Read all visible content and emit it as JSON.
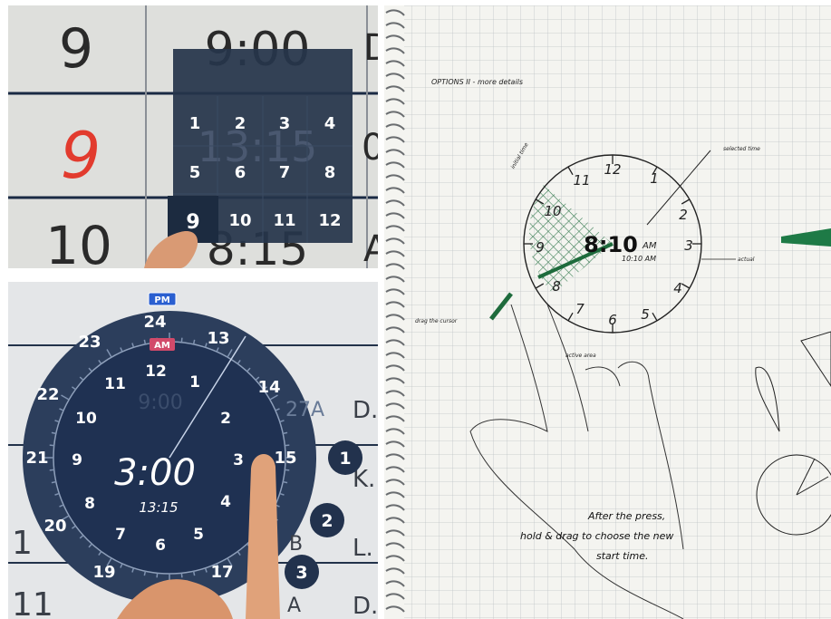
{
  "panel1": {
    "row_hours": [
      "9",
      "9",
      "10"
    ],
    "cells": [
      "9:00",
      "13:15",
      "8:15"
    ],
    "row_edge_letters": [
      "D",
      "0",
      "A"
    ],
    "keypad_keys": [
      "1",
      "2",
      "3",
      "4",
      "5",
      "6",
      "7",
      "8",
      "9",
      "10",
      "11",
      "12"
    ],
    "pressed_key": "9"
  },
  "panel2": {
    "pm_badge": "PM",
    "am_badge": "AM",
    "outer_hours": [
      "24",
      "13",
      "14",
      "15",
      "17",
      "19",
      "20",
      "21",
      "22",
      "23"
    ],
    "inner_hours": [
      "12",
      "1",
      "2",
      "3",
      "4",
      "5",
      "6",
      "7",
      "8",
      "9",
      "10",
      "11"
    ],
    "time_display": "3:00",
    "time_24h": "13:15",
    "right_letters": [
      "D.",
      "K.",
      "L.",
      "D."
    ],
    "left_edge": [
      "1",
      "11"
    ],
    "right_fragments": [
      "27A",
      "B",
      "A"
    ],
    "bubbles": [
      "1",
      "2",
      "3"
    ],
    "behind_text": "9:00"
  },
  "sketch": {
    "title": "OPTIONS II - more details",
    "clock_numbers": [
      "12",
      "1",
      "2",
      "3",
      "4",
      "5",
      "6",
      "7",
      "8",
      "9",
      "10",
      "11"
    ],
    "time_big": "8:10",
    "am_label": "AM",
    "subtime": "10:10 AM",
    "label_selected_time": "selected time",
    "label_initial_time": "initial time",
    "label_actual": "actual",
    "label_drag": "drag the cursor",
    "label_active_area": "active area",
    "note_line1": "After the press,",
    "note_line2": "hold & drag to choose the new",
    "note_line3": "start time."
  }
}
